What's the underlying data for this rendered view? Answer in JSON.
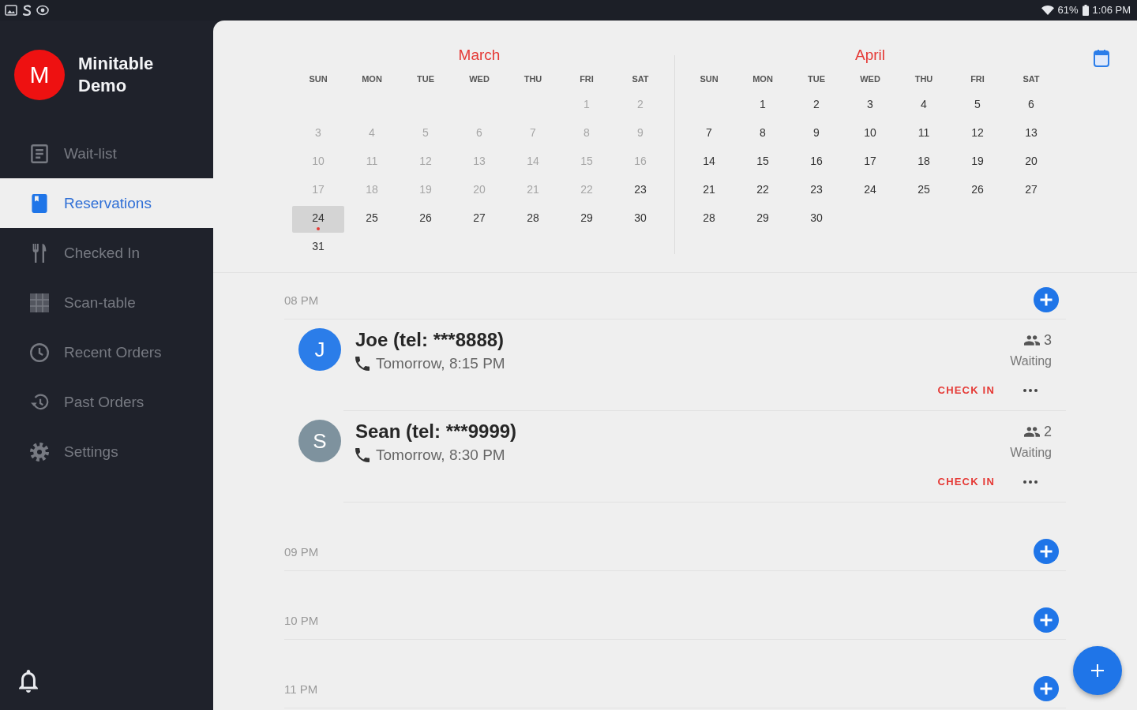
{
  "status_bar": {
    "battery": "61%",
    "time": "1:06 PM"
  },
  "sidebar": {
    "account": {
      "initial": "M",
      "name": "Minitable Demo"
    },
    "items": [
      {
        "label": "Wait-list",
        "selected": false
      },
      {
        "label": "Reservations",
        "selected": true
      },
      {
        "label": "Checked In",
        "selected": false
      },
      {
        "label": "Scan-table",
        "selected": false
      },
      {
        "label": "Recent Orders",
        "selected": false
      },
      {
        "label": "Past Orders",
        "selected": false
      },
      {
        "label": "Settings",
        "selected": false
      }
    ]
  },
  "calendar": {
    "months": [
      {
        "name": "March",
        "weekdays": [
          "SUN",
          "MON",
          "TUE",
          "WED",
          "THU",
          "FRI",
          "SAT"
        ],
        "weeks": [
          {
            "starts_midweek": true,
            "days": [
              {
                "day": "1",
                "disabled": true,
                "selected": false,
                "marked": false
              },
              {
                "day": "2",
                "disabled": true,
                "selected": false,
                "marked": false
              }
            ]
          },
          {
            "starts_midweek": false,
            "days": [
              {
                "day": "3",
                "disabled": true,
                "selected": false,
                "marked": false
              },
              {
                "day": "4",
                "disabled": true,
                "selected": false,
                "marked": false
              },
              {
                "day": "5",
                "disabled": true,
                "selected": false,
                "marked": false
              },
              {
                "day": "6",
                "disabled": true,
                "selected": false,
                "marked": false
              },
              {
                "day": "7",
                "disabled": true,
                "selected": false,
                "marked": false
              },
              {
                "day": "8",
                "disabled": true,
                "selected": false,
                "marked": false
              },
              {
                "day": "9",
                "disabled": true,
                "selected": false,
                "marked": false
              }
            ]
          },
          {
            "starts_midweek": false,
            "days": [
              {
                "day": "10",
                "disabled": true,
                "selected": false,
                "marked": false
              },
              {
                "day": "11",
                "disabled": true,
                "selected": false,
                "marked": false
              },
              {
                "day": "12",
                "disabled": true,
                "selected": false,
                "marked": false
              },
              {
                "day": "13",
                "disabled": true,
                "selected": false,
                "marked": false
              },
              {
                "day": "14",
                "disabled": true,
                "selected": false,
                "marked": false
              },
              {
                "day": "15",
                "disabled": true,
                "selected": false,
                "marked": false
              },
              {
                "day": "16",
                "disabled": true,
                "selected": false,
                "marked": false
              }
            ]
          },
          {
            "starts_midweek": false,
            "days": [
              {
                "day": "17",
                "disabled": true,
                "selected": false,
                "marked": false
              },
              {
                "day": "18",
                "disabled": true,
                "selected": false,
                "marked": false
              },
              {
                "day": "19",
                "disabled": true,
                "selected": false,
                "marked": false
              },
              {
                "day": "20",
                "disabled": true,
                "selected": false,
                "marked": false
              },
              {
                "day": "21",
                "disabled": true,
                "selected": false,
                "marked": false
              },
              {
                "day": "22",
                "disabled": true,
                "selected": false,
                "marked": false
              },
              {
                "day": "23",
                "disabled": false,
                "selected": false,
                "marked": false
              }
            ]
          },
          {
            "starts_midweek": false,
            "days": [
              {
                "day": "24",
                "disabled": false,
                "selected": true,
                "marked": true
              },
              {
                "day": "25",
                "disabled": false,
                "selected": false,
                "marked": false
              },
              {
                "day": "26",
                "disabled": false,
                "selected": false,
                "marked": false
              },
              {
                "day": "27",
                "disabled": false,
                "selected": false,
                "marked": false
              },
              {
                "day": "28",
                "disabled": false,
                "selected": false,
                "marked": false
              },
              {
                "day": "29",
                "disabled": false,
                "selected": false,
                "marked": false
              },
              {
                "day": "30",
                "disabled": false,
                "selected": false,
                "marked": false
              }
            ]
          },
          {
            "starts_midweek": false,
            "days": [
              {
                "day": "31",
                "disabled": false,
                "selected": false,
                "marked": false
              }
            ]
          }
        ]
      },
      {
        "name": "April",
        "weekdays": [
          "SUN",
          "MON",
          "TUE",
          "WED",
          "THU",
          "FRI",
          "SAT"
        ],
        "weeks": [
          {
            "starts_midweek": true,
            "days": [
              {
                "day": "1",
                "disabled": false,
                "selected": false,
                "marked": false
              },
              {
                "day": "2",
                "disabled": false,
                "selected": false,
                "marked": false
              },
              {
                "day": "3",
                "disabled": false,
                "selected": false,
                "marked": false
              },
              {
                "day": "4",
                "disabled": false,
                "selected": false,
                "marked": false
              },
              {
                "day": "5",
                "disabled": false,
                "selected": false,
                "marked": false
              },
              {
                "day": "6",
                "disabled": false,
                "selected": false,
                "marked": false
              }
            ]
          },
          {
            "starts_midweek": false,
            "days": [
              {
                "day": "7",
                "disabled": false,
                "selected": false,
                "marked": false
              },
              {
                "day": "8",
                "disabled": false,
                "selected": false,
                "marked": false
              },
              {
                "day": "9",
                "disabled": false,
                "selected": false,
                "marked": false
              },
              {
                "day": "10",
                "disabled": false,
                "selected": false,
                "marked": false
              },
              {
                "day": "11",
                "disabled": false,
                "selected": false,
                "marked": false
              },
              {
                "day": "12",
                "disabled": false,
                "selected": false,
                "marked": false
              },
              {
                "day": "13",
                "disabled": false,
                "selected": false,
                "marked": false
              }
            ]
          },
          {
            "starts_midweek": false,
            "days": [
              {
                "day": "14",
                "disabled": false,
                "selected": false,
                "marked": false
              },
              {
                "day": "15",
                "disabled": false,
                "selected": false,
                "marked": false
              },
              {
                "day": "16",
                "disabled": false,
                "selected": false,
                "marked": false
              },
              {
                "day": "17",
                "disabled": false,
                "selected": false,
                "marked": false
              },
              {
                "day": "18",
                "disabled": false,
                "selected": false,
                "marked": false
              },
              {
                "day": "19",
                "disabled": false,
                "selected": false,
                "marked": false
              },
              {
                "day": "20",
                "disabled": false,
                "selected": false,
                "marked": false
              }
            ]
          },
          {
            "starts_midweek": false,
            "days": [
              {
                "day": "21",
                "disabled": false,
                "selected": false,
                "marked": false
              },
              {
                "day": "22",
                "disabled": false,
                "selected": false,
                "marked": false
              },
              {
                "day": "23",
                "disabled": false,
                "selected": false,
                "marked": false
              },
              {
                "day": "24",
                "disabled": false,
                "selected": false,
                "marked": false
              },
              {
                "day": "25",
                "disabled": false,
                "selected": false,
                "marked": false
              },
              {
                "day": "26",
                "disabled": false,
                "selected": false,
                "marked": false
              },
              {
                "day": "27",
                "disabled": false,
                "selected": false,
                "marked": false
              }
            ]
          },
          {
            "starts_midweek": false,
            "days": [
              {
                "day": "28",
                "disabled": false,
                "selected": false,
                "marked": false
              },
              {
                "day": "29",
                "disabled": false,
                "selected": false,
                "marked": false
              },
              {
                "day": "30",
                "disabled": false,
                "selected": false,
                "marked": false
              }
            ]
          }
        ]
      }
    ]
  },
  "schedule": {
    "slots": [
      {
        "time": "08 PM",
        "reservations": [
          {
            "initial": "J",
            "color": "#2b7de9",
            "name": "Joe (tel: ***8888)",
            "when": "Tomorrow, 8:15 PM",
            "party": "3",
            "status": "Waiting",
            "action": "CHECK IN"
          },
          {
            "initial": "S",
            "color": "#7e929e",
            "name": "Sean (tel: ***9999)",
            "when": "Tomorrow, 8:30 PM",
            "party": "2",
            "status": "Waiting",
            "action": "CHECK IN"
          }
        ]
      },
      {
        "time": "09 PM"
      },
      {
        "time": "10 PM"
      },
      {
        "time": "11 PM"
      }
    ]
  }
}
